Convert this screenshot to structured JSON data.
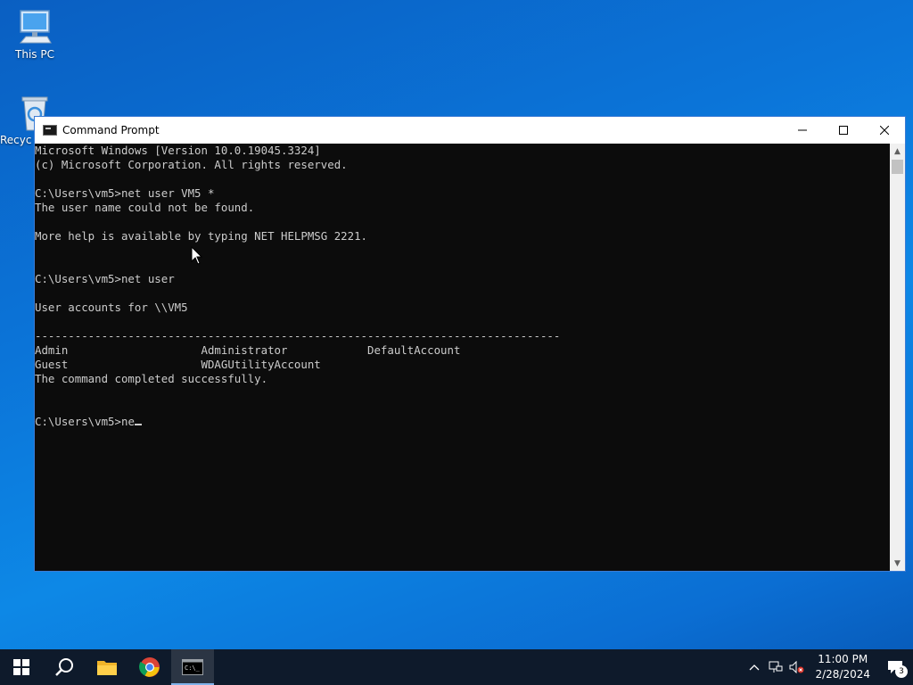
{
  "desktop": {
    "icons": [
      {
        "label": "This PC",
        "icon": "computer-icon"
      },
      {
        "label": "Recyc",
        "icon": "recycle-bin-icon"
      }
    ]
  },
  "window": {
    "title": "Command Prompt",
    "icon": "cmd-icon",
    "controls": {
      "minimize": "minimize-icon",
      "maximize": "maximize-icon",
      "close": "close-icon"
    }
  },
  "console": {
    "lines": [
      "Microsoft Windows [Version 10.0.19045.3324]",
      "(c) Microsoft Corporation. All rights reserved.",
      "",
      "C:\\Users\\vm5>net user VM5 *",
      "The user name could not be found.",
      "",
      "More help is available by typing NET HELPMSG 2221.",
      "",
      "",
      "C:\\Users\\vm5>net user",
      "",
      "User accounts for \\\\VM5",
      "",
      "-------------------------------------------------------------------------------",
      "Admin                    Administrator            DefaultAccount",
      "Guest                    WDAGUtilityAccount",
      "The command completed successfully.",
      "",
      ""
    ],
    "prompt": "C:\\Users\\vm5>",
    "current_input": "ne"
  },
  "taskbar": {
    "items": [
      "start-icon",
      "search-icon",
      "file-explorer-icon",
      "chrome-icon",
      "command-prompt-icon"
    ],
    "active_item": "command-prompt-icon",
    "tray": {
      "time": "11:00 PM",
      "date": "2/28/2024",
      "notification_count": "3"
    }
  },
  "colors": {
    "console_bg": "#0c0c0c",
    "console_text": "#cccccc",
    "taskbar_bg": "#0e1a2b",
    "desktop_bg": "#0b74d8"
  }
}
